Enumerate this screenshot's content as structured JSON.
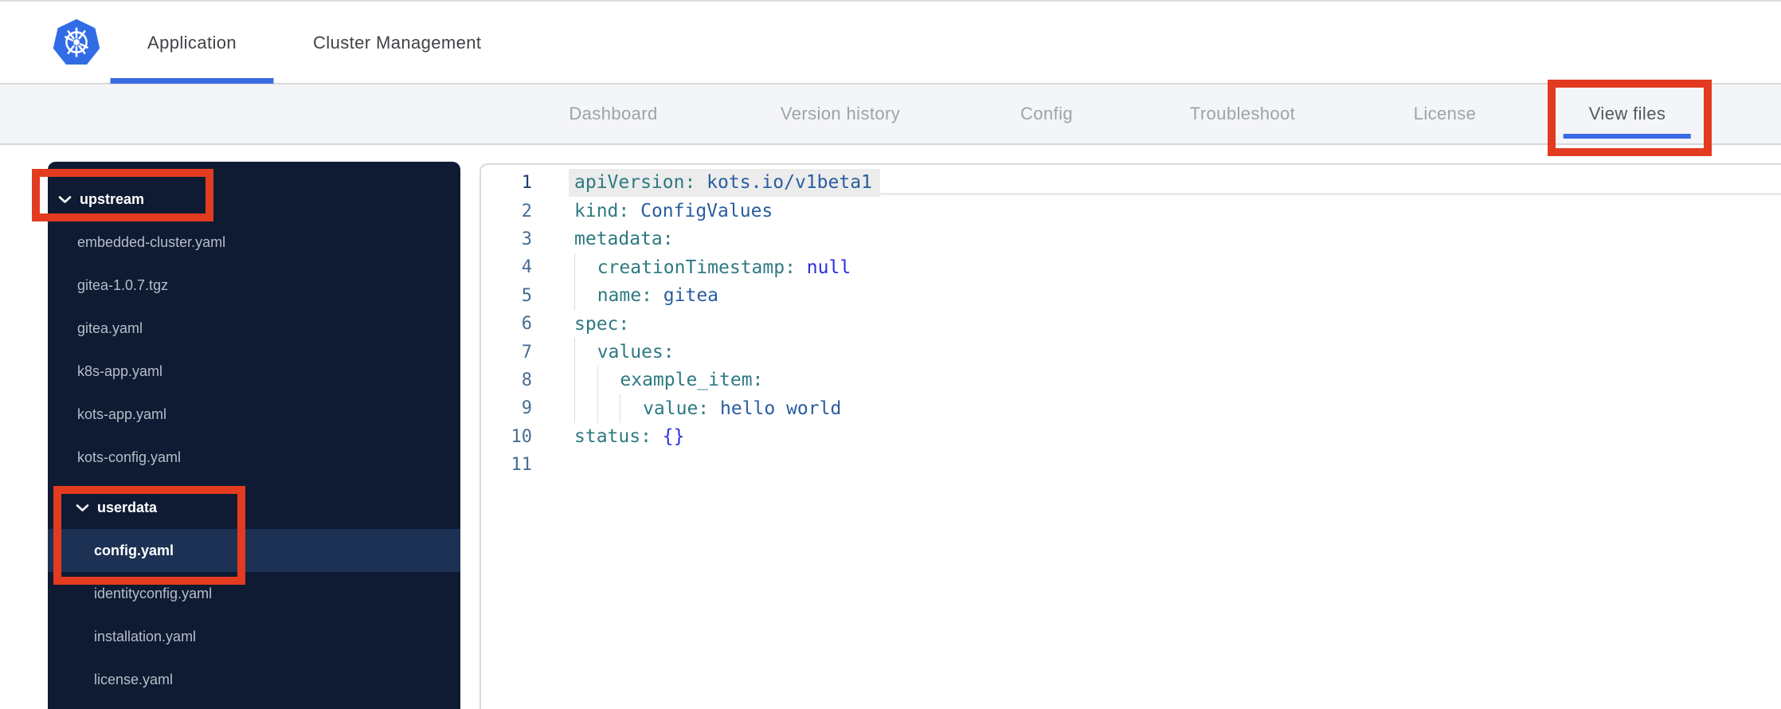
{
  "colors": {
    "accent_blue": "#3b6be4",
    "annotation_red": "#e23b20",
    "kubernetes_blue": "#326ce5",
    "sidebar_bg": "#0e1b33",
    "sidebar_highlight": "#1c3154",
    "code_key": "#2e7a82",
    "code_value": "#2a5d9f",
    "code_constant": "#2a2fe0"
  },
  "topbar": {
    "logo_icon": "kubernetes-helm-wheel",
    "tabs": [
      {
        "label": "Application",
        "active": true
      },
      {
        "label": "Cluster Management",
        "active": false
      }
    ]
  },
  "subnav": {
    "tabs": [
      {
        "label": "Dashboard",
        "active": false
      },
      {
        "label": "Version history",
        "active": false
      },
      {
        "label": "Config",
        "active": false
      },
      {
        "label": "Troubleshoot",
        "active": false
      },
      {
        "label": "License",
        "active": false
      },
      {
        "label": "View files",
        "active": true,
        "annotated": true
      }
    ]
  },
  "file_tree": {
    "items": [
      {
        "name": "upstream",
        "kind": "folder",
        "level": 0,
        "expanded": true,
        "annotated": true
      },
      {
        "name": "embedded-cluster.yaml",
        "kind": "file",
        "level": 1
      },
      {
        "name": "gitea-1.0.7.tgz",
        "kind": "file",
        "level": 1
      },
      {
        "name": "gitea.yaml",
        "kind": "file",
        "level": 1
      },
      {
        "name": "k8s-app.yaml",
        "kind": "file",
        "level": 1
      },
      {
        "name": "kots-app.yaml",
        "kind": "file",
        "level": 1
      },
      {
        "name": "kots-config.yaml",
        "kind": "file",
        "level": 1
      },
      {
        "name": "userdata",
        "kind": "folder",
        "level": 1,
        "expanded": true,
        "annotated": true,
        "gap_top": true
      },
      {
        "name": "config.yaml",
        "kind": "file",
        "level": 2,
        "selected": true,
        "annotated": true
      },
      {
        "name": "identityconfig.yaml",
        "kind": "file",
        "level": 2
      },
      {
        "name": "installation.yaml",
        "kind": "file",
        "level": 2
      },
      {
        "name": "license.yaml",
        "kind": "file",
        "level": 2
      }
    ]
  },
  "editor": {
    "file_shown": "config.yaml",
    "lines": [
      {
        "num": "1",
        "indent": 0,
        "active": true,
        "tokens": [
          {
            "t": "apiVersion:",
            "c": "key"
          },
          {
            "t": " kots.io/v1beta1",
            "c": "val"
          }
        ]
      },
      {
        "num": "2",
        "indent": 0,
        "tokens": [
          {
            "t": "kind:",
            "c": "key"
          },
          {
            "t": " ConfigValues",
            "c": "val"
          }
        ]
      },
      {
        "num": "3",
        "indent": 0,
        "tokens": [
          {
            "t": "metadata:",
            "c": "key"
          }
        ]
      },
      {
        "num": "4",
        "indent": 1,
        "tokens": [
          {
            "t": "creationTimestamp:",
            "c": "key"
          },
          {
            "t": " null",
            "c": "const"
          }
        ]
      },
      {
        "num": "5",
        "indent": 1,
        "tokens": [
          {
            "t": "name:",
            "c": "key"
          },
          {
            "t": " gitea",
            "c": "val"
          }
        ]
      },
      {
        "num": "6",
        "indent": 0,
        "tokens": [
          {
            "t": "spec:",
            "c": "key"
          }
        ]
      },
      {
        "num": "7",
        "indent": 1,
        "tokens": [
          {
            "t": "values:",
            "c": "key"
          }
        ]
      },
      {
        "num": "8",
        "indent": 2,
        "tokens": [
          {
            "t": "example_item:",
            "c": "key"
          }
        ]
      },
      {
        "num": "9",
        "indent": 3,
        "tokens": [
          {
            "t": "value:",
            "c": "key"
          },
          {
            "t": " hello world",
            "c": "val"
          }
        ]
      },
      {
        "num": "10",
        "indent": 0,
        "tokens": [
          {
            "t": "status:",
            "c": "key"
          },
          {
            "t": " {}",
            "c": "const"
          }
        ]
      },
      {
        "num": "11",
        "indent": 0,
        "tokens": []
      }
    ]
  },
  "annotations": {
    "boxes": [
      "upstream-folder",
      "userdata-config-yaml",
      "view-files-tab"
    ]
  }
}
